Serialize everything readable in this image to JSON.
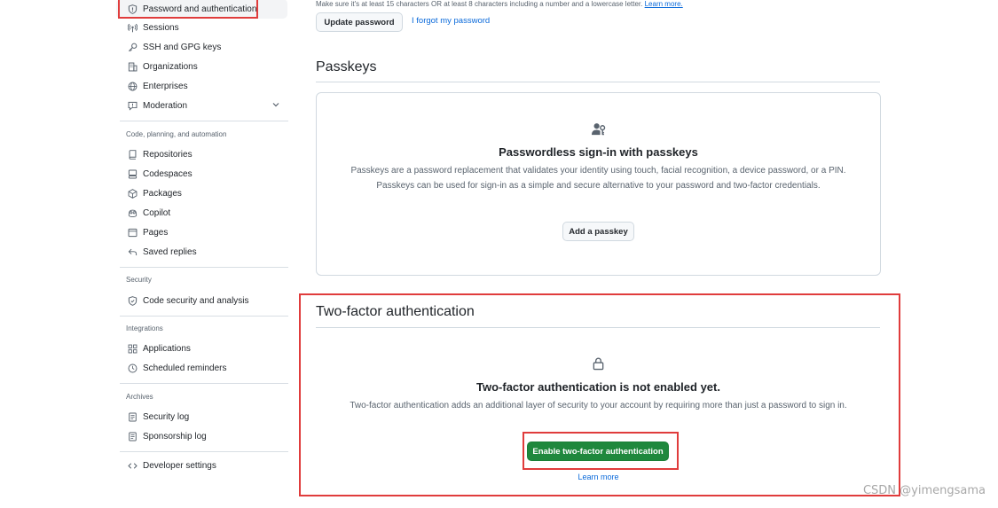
{
  "sidebar": {
    "items_top": [
      {
        "label": "Password and authentication",
        "icon": "shield-lock-icon"
      },
      {
        "label": "Sessions",
        "icon": "broadcast-icon"
      },
      {
        "label": "SSH and GPG keys",
        "icon": "key-icon"
      },
      {
        "label": "Organizations",
        "icon": "organization-icon"
      },
      {
        "label": "Enterprises",
        "icon": "globe-icon"
      },
      {
        "label": "Moderation",
        "icon": "report-icon"
      }
    ],
    "sections": {
      "code": "Code, planning, and automation",
      "security": "Security",
      "integrations": "Integrations",
      "archives": "Archives"
    },
    "code_items": [
      {
        "label": "Repositories",
        "icon": "repo-icon"
      },
      {
        "label": "Codespaces",
        "icon": "codespaces-icon"
      },
      {
        "label": "Packages",
        "icon": "package-icon"
      },
      {
        "label": "Copilot",
        "icon": "copilot-icon"
      },
      {
        "label": "Pages",
        "icon": "browser-icon"
      },
      {
        "label": "Saved replies",
        "icon": "reply-icon"
      }
    ],
    "security_items": [
      {
        "label": "Code security and analysis",
        "icon": "shield-icon"
      }
    ],
    "integration_items": [
      {
        "label": "Applications",
        "icon": "apps-icon"
      },
      {
        "label": "Scheduled reminders",
        "icon": "clock-icon"
      }
    ],
    "archive_items": [
      {
        "label": "Security log",
        "icon": "log-icon"
      },
      {
        "label": "Sponsorship log",
        "icon": "log-icon"
      }
    ],
    "developer": {
      "label": "Developer settings",
      "icon": "code-icon"
    }
  },
  "password": {
    "hint": "Make sure it's at least 15 characters OR at least 8 characters including a number and a lowercase letter.",
    "hint_link": "Learn more.",
    "update_button": "Update password",
    "forgot_link": "I forgot my password"
  },
  "passkeys": {
    "title": "Passkeys",
    "heading": "Passwordless sign-in with passkeys",
    "description": "Passkeys are a password replacement that validates your identity using touch, facial recognition, a device password, or a PIN. Passkeys can be used for sign-in as a simple and secure alternative to your password and two-factor credentials.",
    "add_button": "Add a passkey"
  },
  "two_factor": {
    "title": "Two-factor authentication",
    "heading": "Two-factor authentication is not enabled yet.",
    "description": "Two-factor authentication adds an additional layer of security to your account by requiring more than just a password to sign in.",
    "enable_button": "Enable two-factor authentication",
    "learn_more": "Learn more"
  },
  "watermark": "CSDN @yimengsama",
  "colors": {
    "highlight": "#e03c3c",
    "primary_button": "#1f883d",
    "link": "#0969da"
  }
}
